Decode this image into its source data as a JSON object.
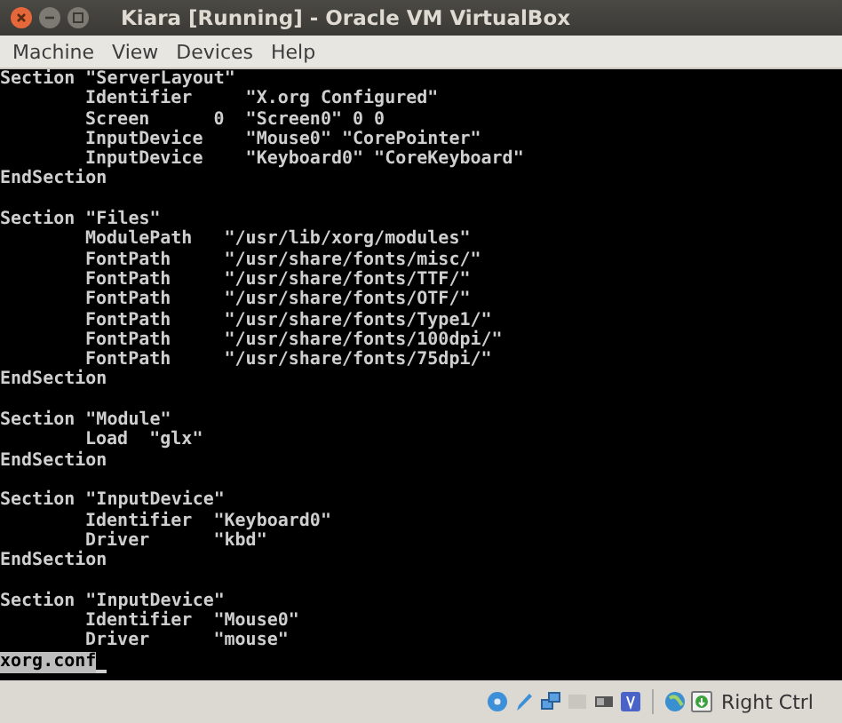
{
  "window": {
    "title": "Kiara [Running] - Oracle VM VirtualBox"
  },
  "menu": [
    "Machine",
    "View",
    "Devices",
    "Help"
  ],
  "console": {
    "sections": [
      {
        "header": "Section \"ServerLayout\"",
        "entries": [
          "Identifier     \"X.org Configured\"",
          "Screen      0  \"Screen0\" 0 0",
          "InputDevice    \"Mouse0\" \"CorePointer\"",
          "InputDevice    \"Keyboard0\" \"CoreKeyboard\""
        ],
        "footer": "EndSection"
      },
      {
        "header": "Section \"Files\"",
        "entries": [
          "ModulePath   \"/usr/lib/xorg/modules\"",
          "FontPath     \"/usr/share/fonts/misc/\"",
          "FontPath     \"/usr/share/fonts/TTF/\"",
          "FontPath     \"/usr/share/fonts/OTF/\"",
          "FontPath     \"/usr/share/fonts/Type1/\"",
          "FontPath     \"/usr/share/fonts/100dpi/\"",
          "FontPath     \"/usr/share/fonts/75dpi/\""
        ],
        "footer": "EndSection"
      },
      {
        "header": "Section \"Module\"",
        "entries": [
          "Load  \"glx\""
        ],
        "footer": "EndSection"
      },
      {
        "header": "Section \"InputDevice\"",
        "entries": [
          "Identifier  \"Keyboard0\"",
          "Driver      \"kbd\""
        ],
        "footer": "EndSection"
      },
      {
        "header": "Section \"InputDevice\"",
        "entries": [
          "Identifier  \"Mouse0\"",
          "Driver      \"mouse\""
        ]
      }
    ],
    "status_line": "xorg.conf"
  },
  "status_bar": {
    "host_key": "Right Ctrl"
  }
}
